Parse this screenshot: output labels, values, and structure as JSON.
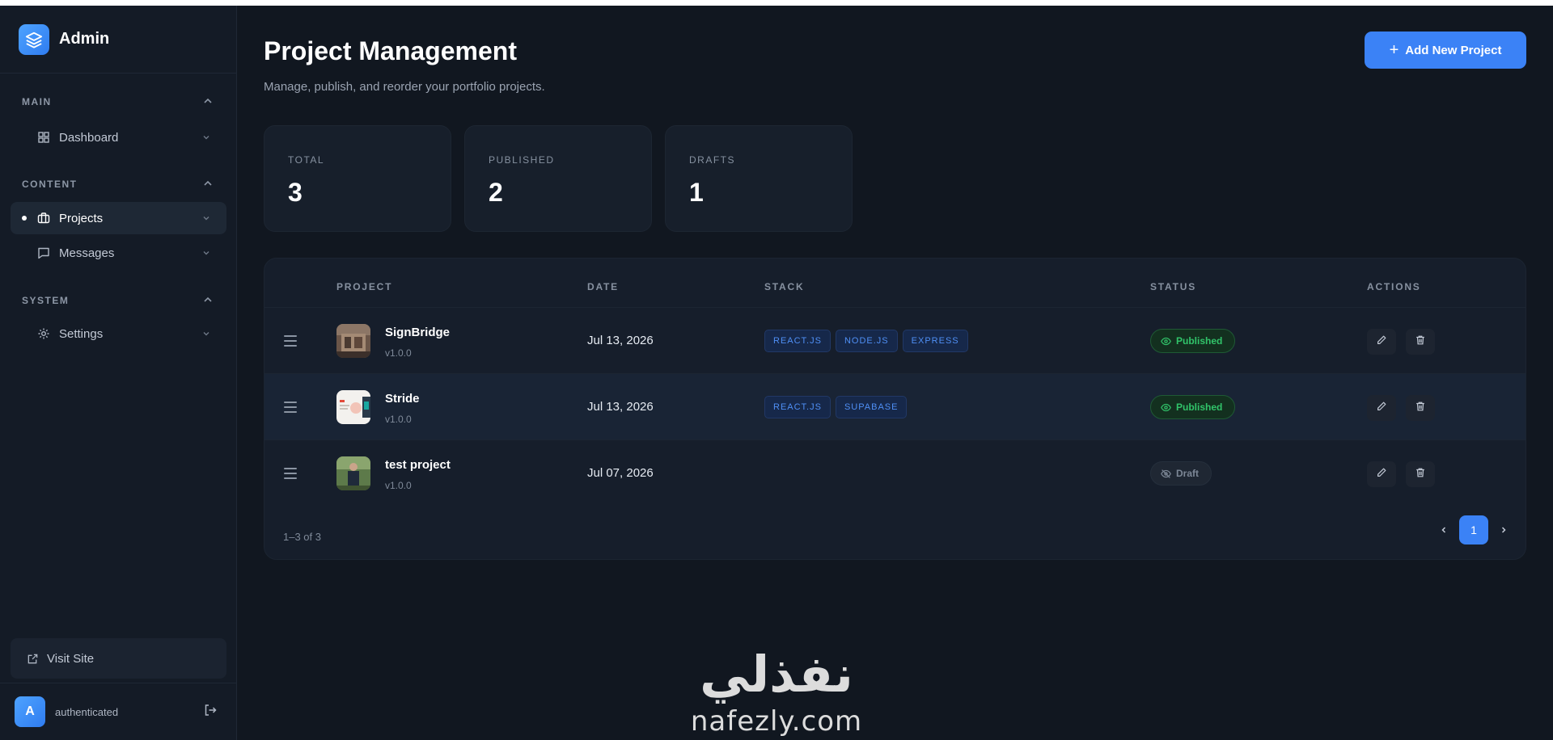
{
  "sidebar": {
    "brand": "Admin",
    "sections": [
      {
        "title": "MAIN",
        "items": [
          {
            "label": "Dashboard",
            "icon": "grid-icon"
          }
        ]
      },
      {
        "title": "CONTENT",
        "items": [
          {
            "label": "Projects",
            "icon": "briefcase-icon",
            "active": true
          },
          {
            "label": "Messages",
            "icon": "message-icon"
          }
        ]
      },
      {
        "title": "SYSTEM",
        "items": [
          {
            "label": "Settings",
            "icon": "gear-icon"
          }
        ]
      }
    ],
    "visit_site": "Visit Site",
    "user": {
      "initial": "A",
      "name": "authenticated"
    }
  },
  "header": {
    "title": "Project Management",
    "subtitle": "Manage, publish, and reorder your portfolio projects.",
    "add_button": "Add New Project"
  },
  "stats": [
    {
      "label": "TOTAL",
      "value": "3"
    },
    {
      "label": "PUBLISHED",
      "value": "2"
    },
    {
      "label": "DRAFTS",
      "value": "1"
    }
  ],
  "table": {
    "columns": [
      "PROJECT",
      "DATE",
      "STACK",
      "STATUS",
      "ACTIONS"
    ],
    "rows": [
      {
        "name": "SignBridge",
        "version": "v1.0.0",
        "date": "Jul 13, 2026",
        "stack": [
          "REACT.JS",
          "NODE.JS",
          "EXPRESS"
        ],
        "status": "Published"
      },
      {
        "name": "Stride",
        "version": "v1.0.0",
        "date": "Jul 13, 2026",
        "stack": [
          "REACT.JS",
          "SUPABASE"
        ],
        "status": "Published"
      },
      {
        "name": "test project",
        "version": "v1.0.0",
        "date": "Jul 07, 2026",
        "stack": [],
        "status": "Draft"
      }
    ],
    "count_text": "1–3 of 3",
    "current_page": "1"
  },
  "watermark": {
    "arabic": "نفذلي",
    "latin": "nafezly.com"
  },
  "colors": {
    "accent": "#3b82f6",
    "published": "#31c46a",
    "tag": "#4f8ff5",
    "background": "#111720"
  }
}
